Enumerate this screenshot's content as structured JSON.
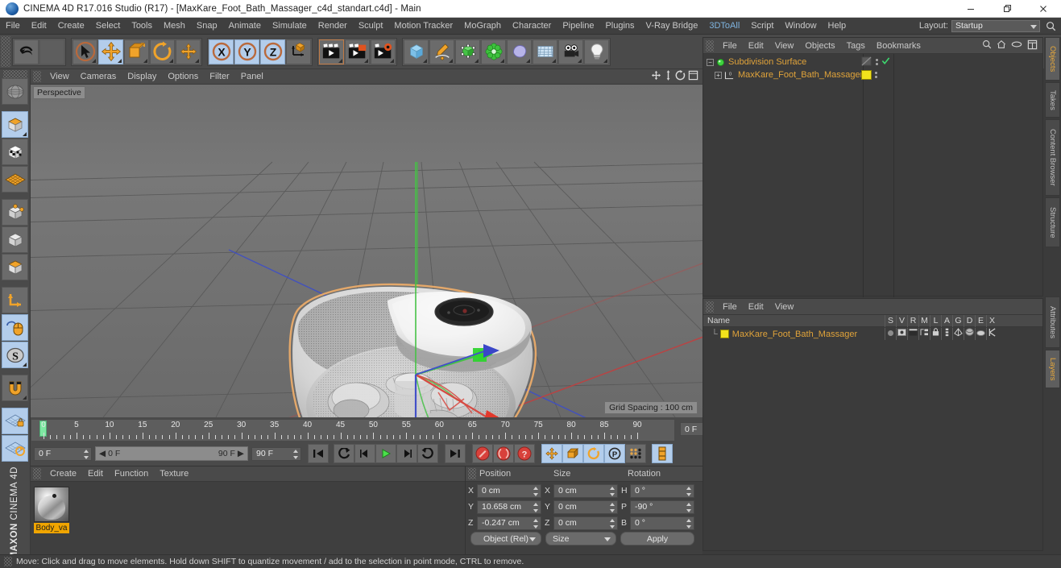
{
  "window": {
    "title": "CINEMA 4D R17.016 Studio (R17) - [MaxKare_Foot_Bath_Massager_c4d_standart.c4d] - Main",
    "minimize_label": "—",
    "maximize_label": "❐",
    "close_label": "✕"
  },
  "menubar": {
    "items": [
      {
        "label": "File"
      },
      {
        "label": "Edit"
      },
      {
        "label": "Create"
      },
      {
        "label": "Select"
      },
      {
        "label": "Tools"
      },
      {
        "label": "Mesh"
      },
      {
        "label": "Snap"
      },
      {
        "label": "Animate"
      },
      {
        "label": "Simulate"
      },
      {
        "label": "Render"
      },
      {
        "label": "Sculpt"
      },
      {
        "label": "Motion Tracker"
      },
      {
        "label": "MoGraph"
      },
      {
        "label": "Character"
      },
      {
        "label": "Pipeline"
      },
      {
        "label": "Plugins"
      },
      {
        "label": "V-Ray Bridge"
      },
      {
        "label": "3DToAll"
      },
      {
        "label": "Script"
      },
      {
        "label": "Window"
      },
      {
        "label": "Help"
      }
    ],
    "layout_label": "Layout:",
    "layout_value": "Startup",
    "search_icon": "search-icon"
  },
  "toolbar": {
    "groups": [
      {
        "name": "history",
        "buttons": [
          {
            "name": "undo-button",
            "icon": "undo-icon",
            "selected": false
          },
          {
            "name": "redo-button",
            "icon": "redo-icon",
            "selected": false,
            "disabled": true
          }
        ]
      },
      {
        "name": "transform-tools",
        "buttons": [
          {
            "name": "live-selection-tool",
            "icon": "live-selection-icon",
            "selected": false
          },
          {
            "name": "move-tool",
            "icon": "move-icon",
            "selected": true
          },
          {
            "name": "scale-tool",
            "icon": "scale-icon",
            "selected": false
          },
          {
            "name": "rotate-tool",
            "icon": "rotate-icon",
            "selected": false
          },
          {
            "name": "move-axis-tool",
            "icon": "move-axis-icon",
            "selected": false
          }
        ]
      },
      {
        "name": "axis-locks",
        "buttons": [
          {
            "name": "x-axis-lock",
            "icon": "x-axis-icon",
            "label": "X",
            "selected": true
          },
          {
            "name": "y-axis-lock",
            "icon": "y-axis-icon",
            "label": "Y",
            "selected": true
          },
          {
            "name": "z-axis-lock",
            "icon": "z-axis-icon",
            "label": "Z",
            "selected": true
          },
          {
            "name": "world-object-coordinate-toggle",
            "icon": "world-coordinate-icon",
            "selected": false
          }
        ]
      },
      {
        "name": "render-tools",
        "buttons": [
          {
            "name": "render-view-button",
            "icon": "render-view-icon",
            "selected": false
          },
          {
            "name": "render-region-button",
            "icon": "render-region-icon",
            "selected": false
          },
          {
            "name": "render-settings-button",
            "icon": "render-settings-icon",
            "selected": false
          }
        ]
      },
      {
        "name": "create-objects",
        "buttons": [
          {
            "name": "add-cube-button",
            "icon": "cube-icon",
            "selected": false
          },
          {
            "name": "add-spline-button",
            "icon": "pen-spline-icon",
            "selected": false
          },
          {
            "name": "add-generator-button",
            "icon": "generator-icon",
            "selected": false
          },
          {
            "name": "add-modeling-object-button",
            "icon": "modeling-object-icon",
            "selected": false
          },
          {
            "name": "add-deformer-button",
            "icon": "deformer-icon",
            "selected": false
          },
          {
            "name": "add-environment-button",
            "icon": "environment-icon",
            "selected": false
          },
          {
            "name": "add-camera-button",
            "icon": "camera-icon",
            "selected": false
          },
          {
            "name": "add-light-button",
            "icon": "light-bulb-icon",
            "selected": false
          }
        ]
      }
    ]
  },
  "left_toolbar": {
    "buttons": [
      {
        "name": "make-editable-button",
        "icon": "make-editable-icon",
        "selected": false
      },
      {
        "name": "model-mode-button",
        "icon": "model-mode-icon",
        "selected": true
      },
      {
        "name": "texture-mode-button",
        "icon": "texture-mode-icon",
        "selected": false
      },
      {
        "name": "workplane-mode-button",
        "icon": "workplane-icon",
        "selected": false
      },
      {
        "name": "point-mode-button",
        "icon": "point-mode-icon",
        "selected": false
      },
      {
        "name": "edge-mode-button",
        "icon": "edge-mode-icon",
        "selected": false
      },
      {
        "name": "polygon-mode-button",
        "icon": "polygon-mode-icon",
        "selected": false
      },
      {
        "name": "axis-mode-button",
        "icon": "axis-mode-icon",
        "selected": false
      },
      {
        "name": "viewport-solo-button",
        "icon": "mouse-icon",
        "selected": true
      },
      {
        "name": "soft-selection-button",
        "icon": "soft-selection-icon",
        "selected": true
      },
      {
        "name": "snap-button",
        "icon": "magnet-icon",
        "selected": false
      },
      {
        "name": "workplane-lock-button",
        "icon": "workplane-lock-icon",
        "selected": true
      },
      {
        "name": "workplane-rotate-button",
        "icon": "workplane-rotate-icon",
        "selected": false
      }
    ],
    "brand_line1": "MAXON",
    "brand_line2": "CINEMA 4D"
  },
  "viewport": {
    "menus": [
      {
        "label": "View"
      },
      {
        "label": "Cameras"
      },
      {
        "label": "Display"
      },
      {
        "label": "Options"
      },
      {
        "label": "Filter"
      },
      {
        "label": "Panel"
      }
    ],
    "nav_icons": [
      {
        "name": "pan-view-icon"
      },
      {
        "name": "dolly-view-icon"
      },
      {
        "name": "rotate-view-icon"
      },
      {
        "name": "maximize-view-icon"
      }
    ],
    "label": "Perspective",
    "grid_spacing": "Grid Spacing : 100 cm",
    "axis_gizmo": {
      "x": "X",
      "y": "Y",
      "z": "Z"
    }
  },
  "timeline": {
    "ticks": [
      "0",
      "5",
      "10",
      "15",
      "20",
      "25",
      "30",
      "35",
      "40",
      "45",
      "50",
      "55",
      "60",
      "65",
      "70",
      "75",
      "80",
      "85",
      "90"
    ],
    "current_frame_field": "0 F",
    "start_frame_field": "0 F",
    "range_start": "0 F",
    "range_end": "90 F",
    "end_frame_field": "90 F",
    "playhead_frame": 0,
    "transport": [
      {
        "name": "go-to-start-button",
        "icon": "go-to-start-icon"
      },
      {
        "name": "previous-key-button",
        "icon": "previous-key-icon"
      },
      {
        "name": "step-back-button",
        "icon": "step-back-icon"
      },
      {
        "name": "play-button",
        "icon": "play-icon"
      },
      {
        "name": "step-forward-button",
        "icon": "step-forward-icon"
      },
      {
        "name": "next-key-button",
        "icon": "next-key-icon"
      },
      {
        "name": "go-to-end-button",
        "icon": "go-to-end-icon"
      }
    ],
    "record_group": [
      {
        "name": "record-active-objects-button",
        "icon": "record-icon"
      },
      {
        "name": "autokeying-button",
        "icon": "autokey-icon"
      },
      {
        "name": "keyframe-selection-button",
        "icon": "keyframe-selection-icon"
      }
    ],
    "key_group": [
      {
        "name": "position-key-button",
        "icon": "position-key-icon",
        "selected": true
      },
      {
        "name": "scale-key-button",
        "icon": "scale-key-icon",
        "selected": true
      },
      {
        "name": "rotation-key-button",
        "icon": "rotation-key-icon",
        "selected": true
      },
      {
        "name": "parameter-key-button",
        "icon": "parameter-key-icon",
        "selected": true
      },
      {
        "name": "point-level-animation-button",
        "icon": "point-level-animation-icon",
        "selected": false
      }
    ],
    "extra": [
      {
        "name": "timeline-layout-button",
        "icon": "timeline-layout-icon",
        "selected": true
      }
    ]
  },
  "material_manager": {
    "menus": [
      {
        "label": "Create"
      },
      {
        "label": "Edit"
      },
      {
        "label": "Function"
      },
      {
        "label": "Texture"
      }
    ],
    "materials": [
      {
        "name": "Body_va",
        "thumb": "sphere-material-preview",
        "selected": true
      }
    ]
  },
  "coordinates": {
    "columns": [
      {
        "label": "Position"
      },
      {
        "label": "Size"
      },
      {
        "label": "Rotation"
      }
    ],
    "rows": [
      {
        "pos_label": "X",
        "pos_value": "0 cm",
        "size_label": "X",
        "size_value": "0 cm",
        "rot_label": "H",
        "rot_value": "0 °"
      },
      {
        "pos_label": "Y",
        "pos_value": "10.658 cm",
        "size_label": "Y",
        "size_value": "0 cm",
        "rot_label": "P",
        "rot_value": "-90 °"
      },
      {
        "pos_label": "Z",
        "pos_value": "-0.247 cm",
        "size_label": "Z",
        "size_value": "0 cm",
        "rot_label": "B",
        "rot_value": "0 °"
      }
    ],
    "coord_system": "Object (Rel)",
    "size_mode": "Size",
    "apply_label": "Apply"
  },
  "object_manager": {
    "menus": [
      {
        "label": "File"
      },
      {
        "label": "Edit"
      },
      {
        "label": "View"
      },
      {
        "label": "Objects"
      },
      {
        "label": "Tags"
      },
      {
        "label": "Bookmarks"
      }
    ],
    "right_icons": [
      {
        "name": "search-icon"
      },
      {
        "name": "home-icon"
      },
      {
        "name": "scroll-to-object-icon"
      },
      {
        "name": "fit-to-window-icon"
      }
    ],
    "items": [
      {
        "name": "Subdivision Surface",
        "icon": "subdivision-surface-icon",
        "depth": 0,
        "enabled_check": true
      },
      {
        "name": "MaxKare_Foot_Bath_Massager",
        "icon": "polygon-object-icon",
        "depth": 1,
        "tag_color": "#f2e21c"
      }
    ]
  },
  "layer_manager": {
    "menus": [
      {
        "label": "File"
      },
      {
        "label": "Edit"
      },
      {
        "label": "View"
      }
    ],
    "name_column": "Name",
    "columns": [
      "S",
      "V",
      "R",
      "M",
      "L",
      "A",
      "G",
      "D",
      "E",
      "X"
    ],
    "rows": [
      {
        "name": "MaxKare_Foot_Bath_Massager",
        "swatch": "#f2e21c",
        "cells": [
          "solo-dot",
          "view-icon",
          "render-icon",
          "manager-icon",
          "lock-icon",
          "animation-icon",
          "generator-icon",
          "deformer-icon",
          "expression-icon",
          "xref-icon"
        ]
      }
    ]
  },
  "vertical_tabs": {
    "top_group": [
      {
        "label": "Objects",
        "active": true
      },
      {
        "label": "Takes",
        "active": false
      },
      {
        "label": "Content Browser",
        "active": false
      },
      {
        "label": "Structure",
        "active": false
      }
    ],
    "bottom_group": [
      {
        "label": "Attributes",
        "active": false
      },
      {
        "label": "Layers",
        "active": true
      }
    ]
  },
  "statusbar": {
    "message": "Move: Click and drag to move elements. Hold down SHIFT to quantize movement / add to the selection in point mode, CTRL to remove."
  },
  "colors": {
    "accent_orange": "#e0a33a",
    "selection_blue": "#b3cdeb",
    "panel_bg": "#3b3b3b",
    "toolbar_bg": "#4a4a4a",
    "axis_x": "#d6453e",
    "axis_y": "#5dd05d",
    "axis_z": "#4b5ed8",
    "tag_yellow": "#f2e21c"
  }
}
